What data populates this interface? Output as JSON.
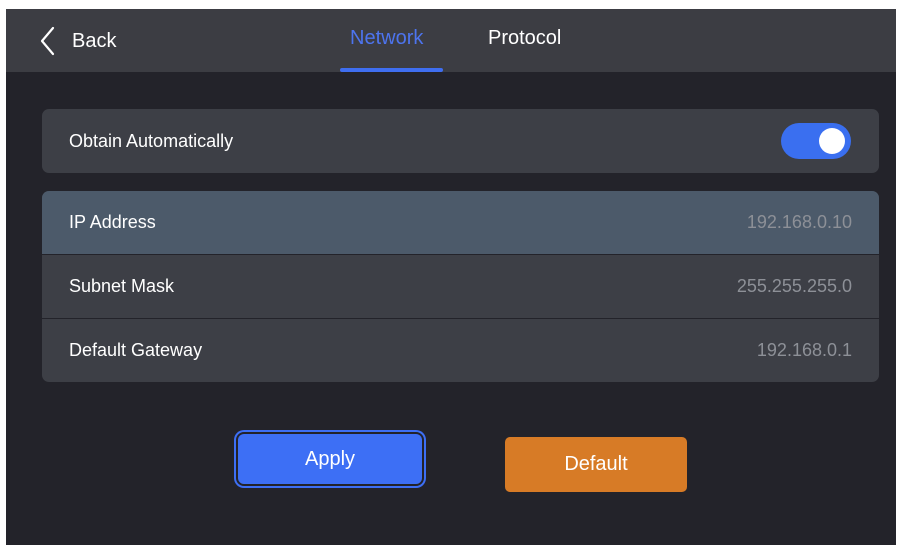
{
  "colors": {
    "accent": "#3f6ef0",
    "active_tab": "#4d74ee",
    "default_button": "#d77b26",
    "value_text": "#8d9097"
  },
  "header": {
    "back_label": "Back",
    "tabs": [
      {
        "label": "Network",
        "active": true
      },
      {
        "label": "Protocol",
        "active": false
      }
    ]
  },
  "obtain": {
    "label": "Obtain Automatically",
    "enabled": true
  },
  "fields": [
    {
      "label": "IP Address",
      "value": "192.168.0.10",
      "selected": true
    },
    {
      "label": "Subnet Mask",
      "value": "255.255.255.0",
      "selected": false
    },
    {
      "label": "Default Gateway",
      "value": "192.168.0.1",
      "selected": false
    }
  ],
  "buttons": {
    "apply_label": "Apply",
    "default_label": "Default"
  }
}
